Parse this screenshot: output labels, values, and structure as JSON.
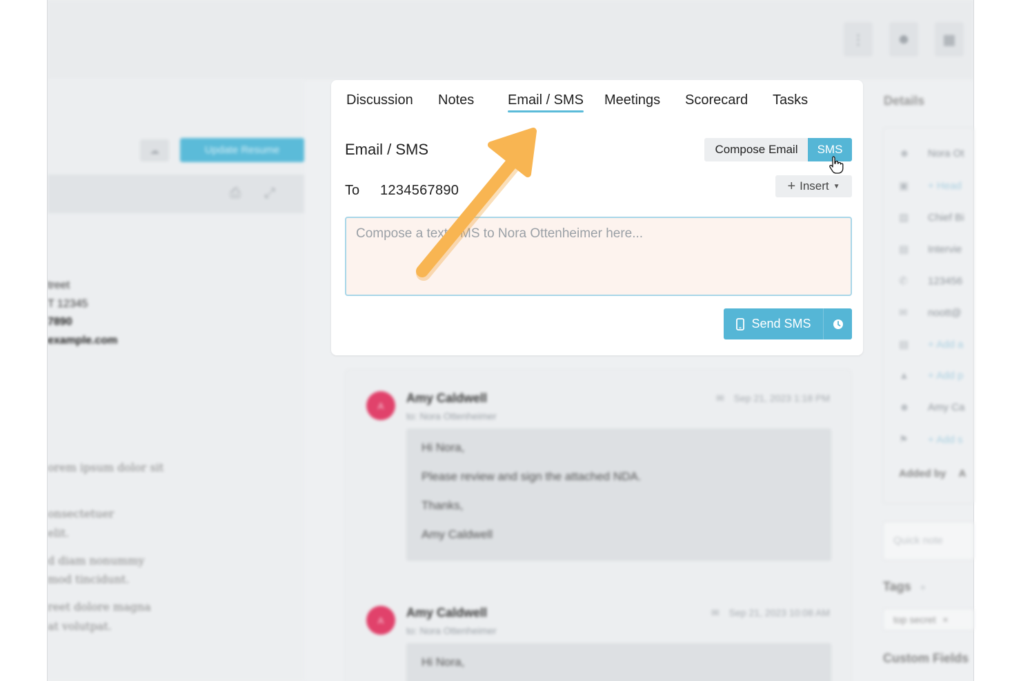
{
  "topbar": {
    "buttons": [
      {
        "icon": "info-icon"
      },
      {
        "icon": "user-add-icon"
      },
      {
        "icon": "grid-icon"
      }
    ]
  },
  "left_panel": {
    "update_resume_label": "Update Resume",
    "address_lines": [
      "treet",
      "T 12345"
    ],
    "phone_partial": "7890",
    "email_partial": "example.com",
    "body_lines": [
      "orem ipsum dolor sit",
      "onsectetuer",
      "elit.",
      "d diam nonummy",
      "mod tincidunt.",
      "reet dolore magna",
      "at volutpat."
    ]
  },
  "tabs": [
    {
      "label": "Discussion",
      "active": false
    },
    {
      "label": "Notes",
      "active": false
    },
    {
      "label": "Email / SMS",
      "active": true
    },
    {
      "label": "Meetings",
      "active": false
    },
    {
      "label": "Scorecard",
      "active": false
    },
    {
      "label": "Tasks",
      "active": false
    }
  ],
  "composer": {
    "title": "Email / SMS",
    "compose_email_label": "Compose Email",
    "sms_label": "SMS",
    "to_label": "To",
    "to_value": "1234567890",
    "insert_label": "Insert",
    "placeholder": "Compose a text SMS to Nora Ottenheimer here...",
    "send_label": "Send SMS"
  },
  "messages": [
    {
      "avatar": "A",
      "sender": "Amy Caldwell",
      "to": "to: Nora Ottenheimer",
      "date": "Sep 21, 2023 1:18 PM",
      "body": [
        "Hi Nora,",
        "Please review and sign the attached NDA.",
        "Thanks,",
        "Amy Caldwell"
      ]
    },
    {
      "avatar": "A",
      "sender": "Amy Caldwell",
      "to": "to: Nora Ottenheimer",
      "date": "Sep 21, 2023 10:08 AM",
      "body": [
        "Hi Nora,"
      ]
    }
  ],
  "details": {
    "title": "Details",
    "rows": [
      {
        "icon": "person-icon",
        "text": "Nora Ot"
      },
      {
        "icon": "id-card-icon",
        "text": "+ Head"
      },
      {
        "icon": "briefcase-icon",
        "text": "Chief Bi"
      },
      {
        "icon": "calendar-icon",
        "text": "Intervie"
      },
      {
        "icon": "phone-icon",
        "text": "123456"
      },
      {
        "icon": "mail-icon",
        "text": "noott@"
      },
      {
        "icon": "document-icon",
        "text": "+ Add a"
      },
      {
        "icon": "handshake-icon",
        "text": "+ Add p"
      },
      {
        "icon": "user-add-icon",
        "text": "Amy Ca"
      },
      {
        "icon": "flag-icon",
        "text": "+ Add s"
      }
    ],
    "added_by_label": "Added by",
    "added_by_value": "A",
    "quick_note_placeholder": "Quick note",
    "tags_title": "Tags",
    "tag_value": "top secret",
    "custom_fields_title": "Custom Fields"
  },
  "colors": {
    "accent": "#55b6d6",
    "avatar": "#e1426b",
    "arrow": "#f8b552",
    "compose_bg": "#fdf3ee"
  }
}
